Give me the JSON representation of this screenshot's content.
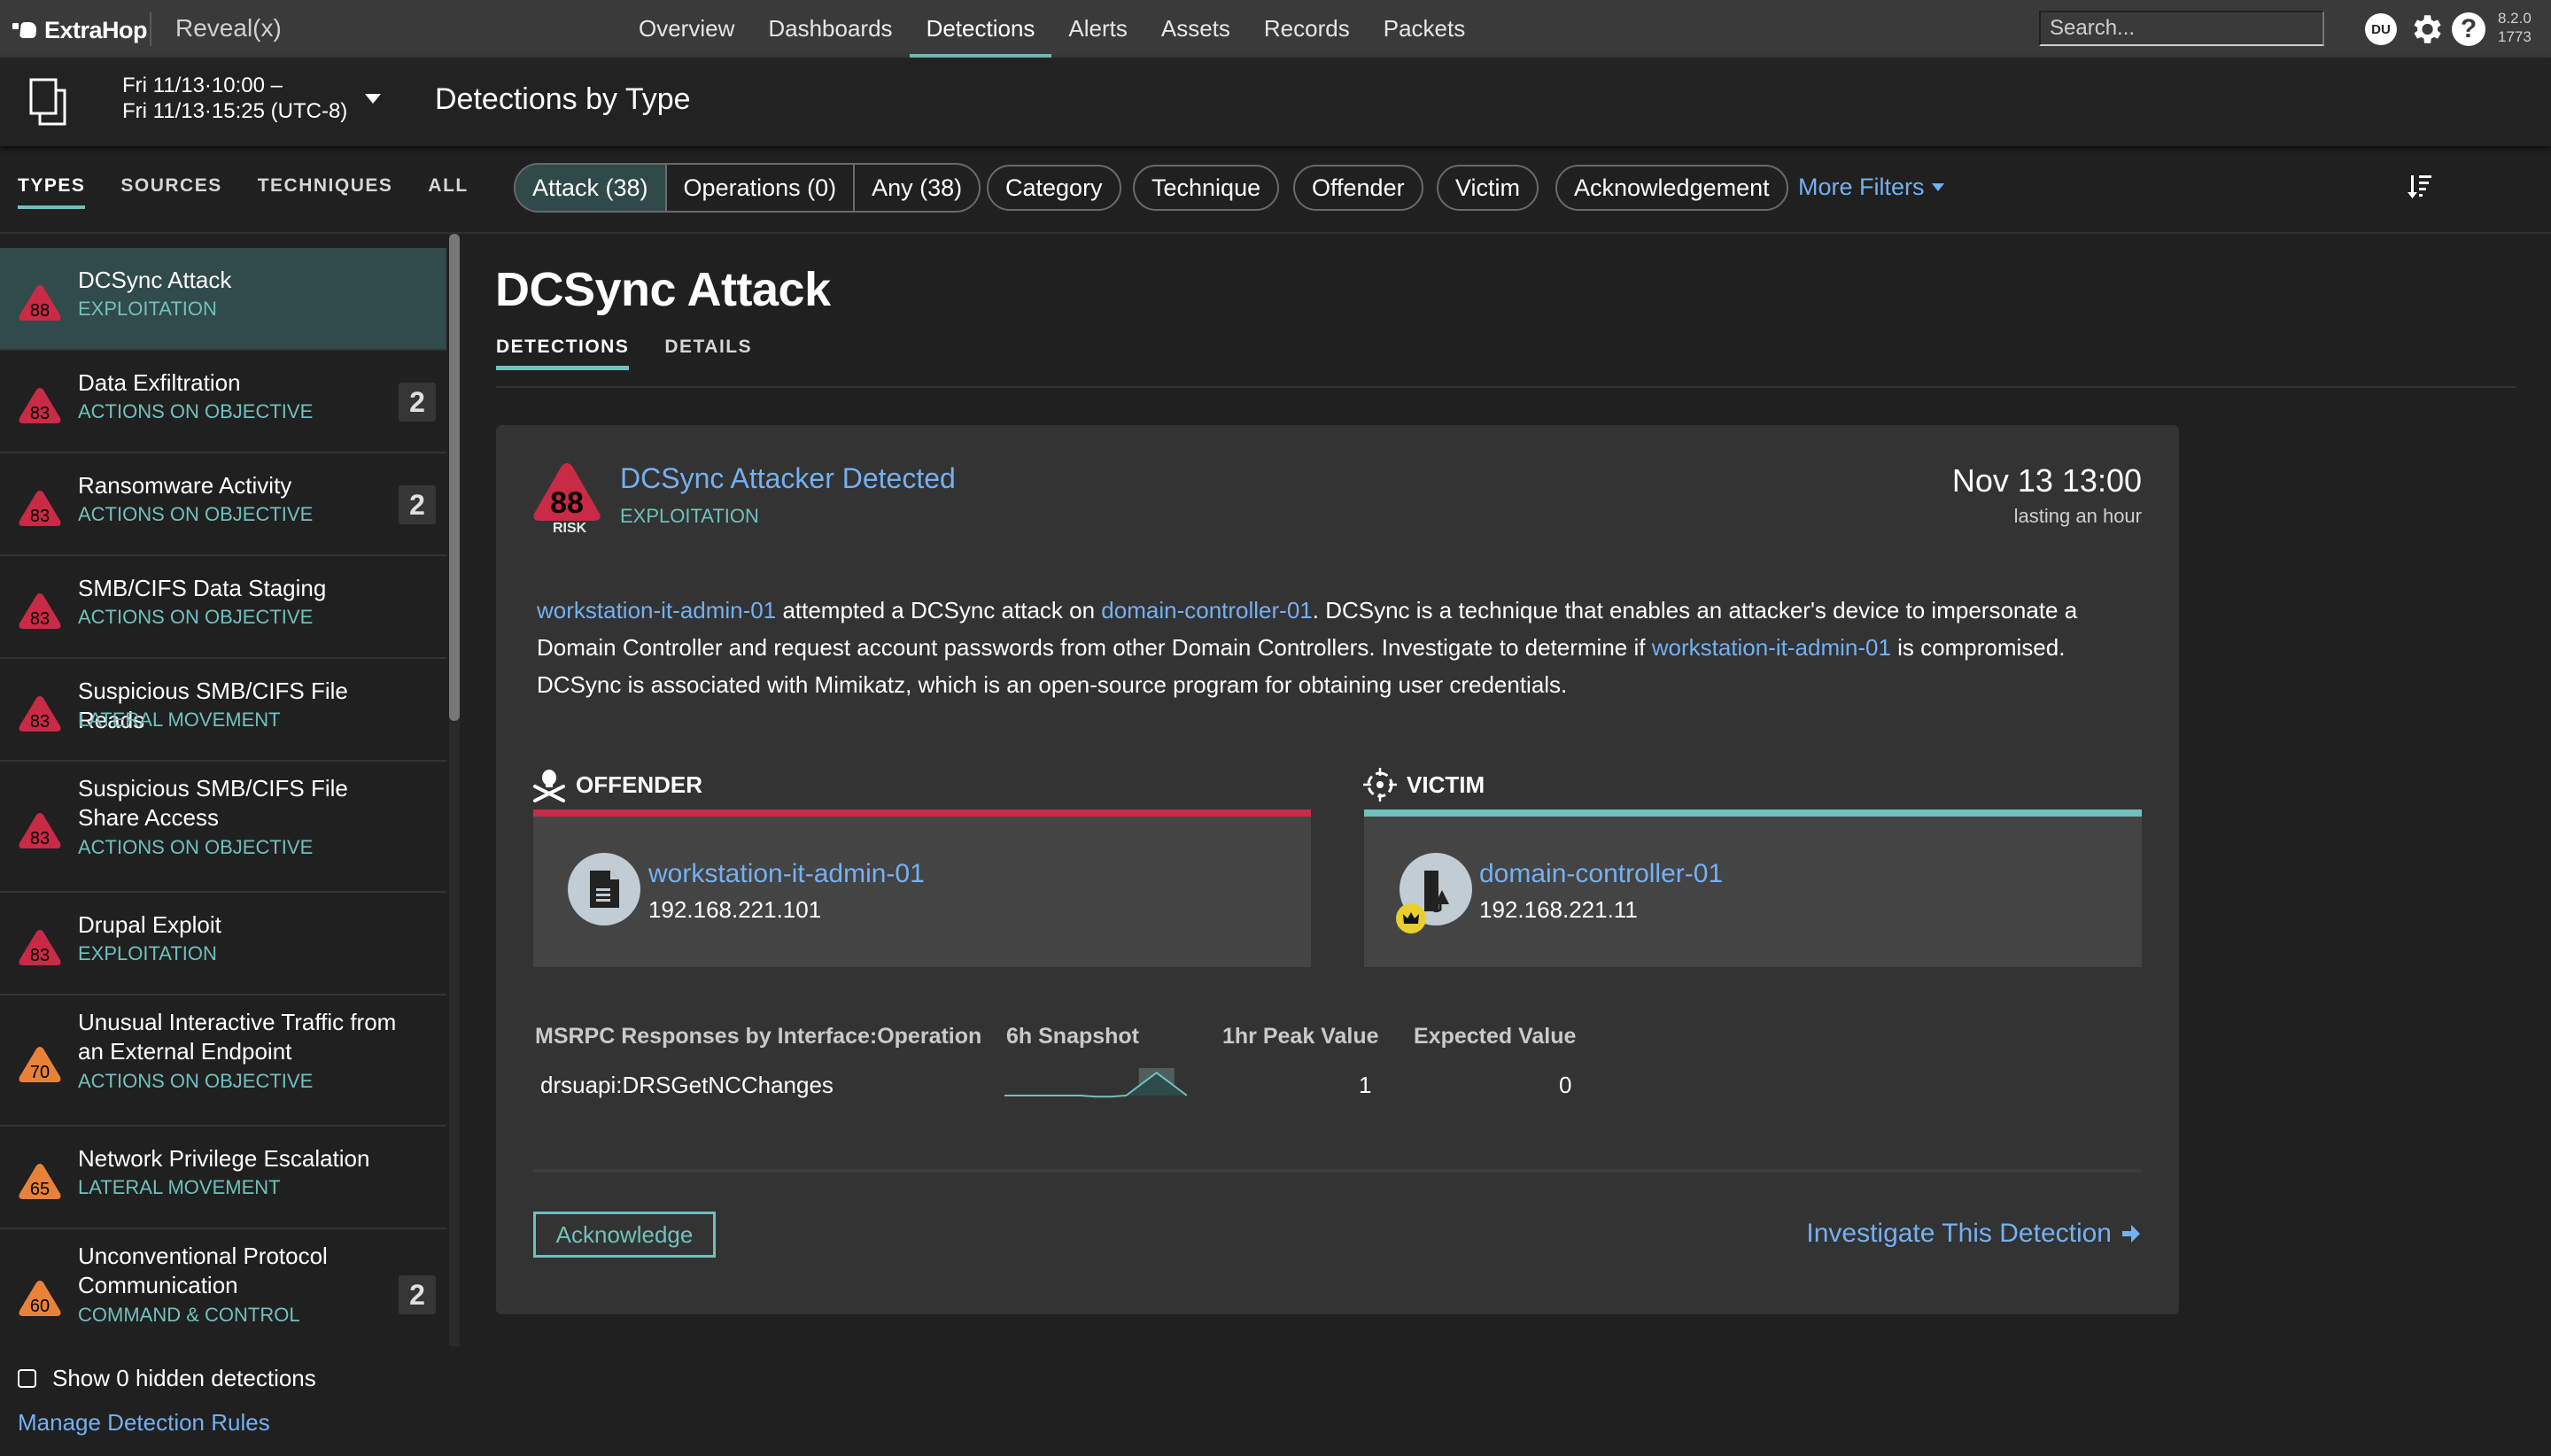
{
  "topnav": {
    "brand": "ExtraHop",
    "product": "Reveal(x)",
    "links": [
      {
        "label": "Overview",
        "active": false
      },
      {
        "label": "Dashboards",
        "active": false
      },
      {
        "label": "Detections",
        "active": true
      },
      {
        "label": "Alerts",
        "active": false
      },
      {
        "label": "Assets",
        "active": false
      },
      {
        "label": "Records",
        "active": false
      },
      {
        "label": "Packets",
        "active": false
      }
    ],
    "search_placeholder": "Search...",
    "user_initials": "DU",
    "help_glyph": "?",
    "version_line1": "8.2.0",
    "version_line2": "1773"
  },
  "subheader": {
    "time_start": "Fri 11/13·10:00 –",
    "time_end": "Fri 11/13·15:25 (UTC-8)",
    "page_title": "Detections by Type"
  },
  "list_tabs": [
    {
      "label": "TYPES",
      "active": true
    },
    {
      "label": "SOURCES",
      "active": false
    },
    {
      "label": "TECHNIQUES",
      "active": false
    },
    {
      "label": "ALL",
      "active": false
    }
  ],
  "filters": {
    "segments": [
      {
        "label": "Attack (38)",
        "active": true
      },
      {
        "label": "Operations (0)",
        "active": false
      },
      {
        "label": "Any (38)",
        "active": false
      }
    ],
    "pills": [
      "Category",
      "Technique",
      "Offender",
      "Victim",
      "Acknowledgement"
    ],
    "more_filters": "More Filters"
  },
  "colors": {
    "accent_teal": "#6fc1bd",
    "link_blue": "#74b0f2",
    "risk_red": "#c92a45",
    "risk_orange": "#e8823a",
    "selected_row": "#314a4a"
  },
  "detection_types": [
    {
      "risk": "88",
      "level": "high",
      "name": "DCSync Attack",
      "category": "EXPLOITATION",
      "count": "",
      "active": true
    },
    {
      "risk": "83",
      "level": "high",
      "name": "Data Exfiltration",
      "category": "ACTIONS ON OBJECTIVE",
      "count": "2",
      "active": false
    },
    {
      "risk": "83",
      "level": "high",
      "name": "Ransomware Activity",
      "category": "ACTIONS ON OBJECTIVE",
      "count": "2",
      "active": false
    },
    {
      "risk": "83",
      "level": "high",
      "name": "SMB/CIFS Data Staging",
      "category": "ACTIONS ON OBJECTIVE",
      "count": "",
      "active": false
    },
    {
      "risk": "83",
      "level": "high",
      "name": "Suspicious SMB/CIFS File Reads",
      "category": "LATERAL MOVEMENT",
      "count": "",
      "active": false
    },
    {
      "risk": "83",
      "level": "high",
      "name": "Suspicious SMB/CIFS File Share Access",
      "category": "ACTIONS ON OBJECTIVE",
      "count": "",
      "active": false
    },
    {
      "risk": "83",
      "level": "high",
      "name": "Drupal Exploit",
      "category": "EXPLOITATION",
      "count": "",
      "active": false
    },
    {
      "risk": "70",
      "level": "medium",
      "name": "Unusual Interactive Traffic from an External Endpoint",
      "category": "ACTIONS ON OBJECTIVE",
      "count": "",
      "active": false
    },
    {
      "risk": "65",
      "level": "medium",
      "name": "Network Privilege Escalation",
      "category": "LATERAL MOVEMENT",
      "count": "",
      "active": false
    },
    {
      "risk": "60",
      "level": "medium",
      "name": "Unconventional Protocol Communication",
      "category": "COMMAND & CONTROL",
      "count": "2",
      "active": false
    }
  ],
  "list_footer": {
    "show_hidden_label": "Show 0 hidden detections",
    "show_hidden_checked": false,
    "manage_rules_label": "Manage Detection Rules"
  },
  "detail": {
    "title": "DCSync Attack",
    "tabs": [
      {
        "label": "DETECTIONS",
        "active": true
      },
      {
        "label": "DETAILS",
        "active": false
      }
    ]
  },
  "detection_card": {
    "risk_score": "88",
    "risk_label": "RISK",
    "title": "DCSync Attacker Detected",
    "category": "EXPLOITATION",
    "time": "Nov 13 13:00",
    "duration": "lasting an hour",
    "description": {
      "link1": "workstation-it-admin-01",
      "text1": " attempted a DCSync attack on ",
      "link2": "domain-controller-01",
      "text2": ". DCSync is a technique that enables an attacker's device to impersonate a Domain Controller and request account passwords from other Domain Controllers. Investigate to determine if ",
      "link3": "workstation-it-admin-01",
      "text3": " is compromised. DCSync is associated with Mimikatz, which is an open-source program for obtaining user credentials."
    },
    "offender": {
      "heading": "OFFENDER",
      "device_name": "workstation-it-admin-01",
      "ip": "192.168.221.101",
      "icon": "document-icon"
    },
    "victim": {
      "heading": "VICTIM",
      "device_name": "domain-controller-01",
      "ip": "192.168.221.11",
      "icon": "domain-controller-icon",
      "critical_badge": "crown-icon"
    },
    "metrics_table": {
      "headers": [
        "MSRPC Responses by Interface:Operation",
        "6h Snapshot",
        "1hr Peak Value",
        "Expected Value"
      ],
      "rows": [
        {
          "operation": "drsuapi:DRSGetNCChanges",
          "snapshot": [
            0,
            0,
            0,
            0,
            0,
            0,
            -0.05,
            -0.05,
            0,
            0.5,
            1,
            0.5,
            0
          ],
          "peak": "1",
          "expected": "0"
        }
      ]
    },
    "acknowledge_label": "Acknowledge",
    "investigate_label": "Investigate This Detection"
  }
}
